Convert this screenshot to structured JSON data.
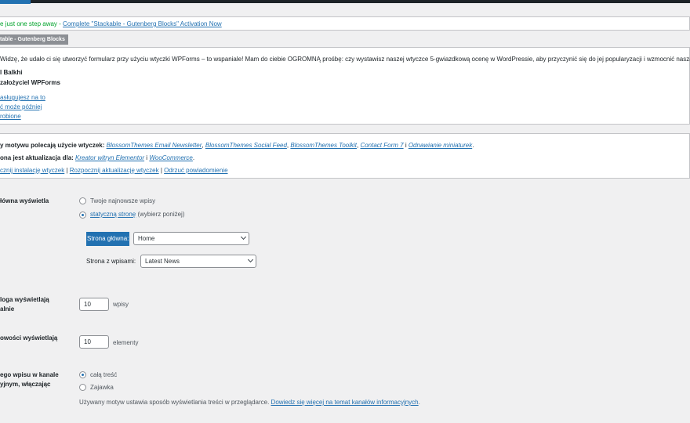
{
  "notice_stackable": {
    "prefix": "e just one step away - ",
    "link": "Complete \"Stackable - Gutenberg Blocks\" Activation Now",
    "tab": "table - Gutenberg Blocks"
  },
  "notice_wpforms": {
    "message": "Widzę, że udało ci się utworzyć formularz przy użyciu wtyczki WPForms – to wspaniale! Mam do ciebie OGROMNĄ prośbę: czy wystawisz naszej wtyczce 5-gwiazdkową ocenę w WordPressie, aby przyczynić się do jej popularyzacji i wzmocnić naszą motywac",
    "signature_name": "l Balkhi",
    "signature_role": "założyciel WPForms",
    "link_deserve": "asługujesz na to",
    "link_later": "ć może później",
    "link_done": "robione"
  },
  "notice_plugins": {
    "recommend_prefix": "y motywu polecają użycie wtyczek: ",
    "recommended": [
      "BlossomThemes Email Newsletter",
      "BlossomThemes Social Feed",
      "BlossomThemes Toolkit",
      "Contact Form 7"
    ],
    "recommend_and": " i ",
    "recommend_last": "Odnawianie miniaturek",
    "update_prefix": "ona jest aktualizacja dla: ",
    "update_plugin1": "Kreator witryn Elementor",
    "update_and": " i ",
    "update_plugin2": "WooCommerce",
    "action_install": "cznij instalację wtyczek",
    "action_update": "Rozpocznij aktualizację wtyczek",
    "action_dismiss": "Odrzuć powiadomienie"
  },
  "settings": {
    "homepage_label": "łówna wyświetla",
    "option_latest": "Twoje najnowsze wpisy",
    "option_static_link": "statyczną stronę",
    "option_static_suffix": " (wybierz poniżej)",
    "front_page_label": "Strona główna:",
    "front_page_value": "Home",
    "posts_page_label": "Strona z wpisami:",
    "posts_page_value": "Latest News",
    "blog_label_line1": "loga wyświetlają",
    "blog_label_line2": "alnie",
    "blog_value": "10",
    "blog_unit": "wpisy",
    "feed_label": "owości wyświetlają",
    "feed_value": "10",
    "feed_unit": "elementy",
    "content_label_line1": "ego wpisu w kanale",
    "content_label_line2": "yjnym, włączając",
    "option_full": "całą treść",
    "option_excerpt": "Zajawka",
    "theme_note": "Używany motyw ustawia sposób wyświetlania treści w przeglądarce. ",
    "theme_note_link": "Dowiedz się więcej na temat kanałów informacyjnych",
    "theme_note_end": "."
  }
}
